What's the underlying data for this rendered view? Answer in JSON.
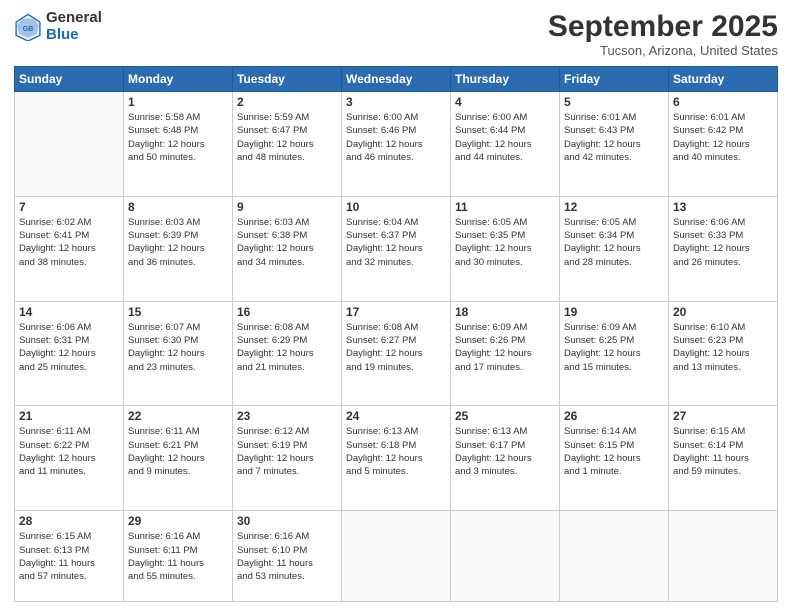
{
  "header": {
    "logo_line1": "General",
    "logo_line2": "Blue",
    "month": "September 2025",
    "location": "Tucson, Arizona, United States"
  },
  "weekdays": [
    "Sunday",
    "Monday",
    "Tuesday",
    "Wednesday",
    "Thursday",
    "Friday",
    "Saturday"
  ],
  "weeks": [
    [
      {
        "day": "",
        "info": ""
      },
      {
        "day": "1",
        "info": "Sunrise: 5:58 AM\nSunset: 6:48 PM\nDaylight: 12 hours\nand 50 minutes."
      },
      {
        "day": "2",
        "info": "Sunrise: 5:59 AM\nSunset: 6:47 PM\nDaylight: 12 hours\nand 48 minutes."
      },
      {
        "day": "3",
        "info": "Sunrise: 6:00 AM\nSunset: 6:46 PM\nDaylight: 12 hours\nand 46 minutes."
      },
      {
        "day": "4",
        "info": "Sunrise: 6:00 AM\nSunset: 6:44 PM\nDaylight: 12 hours\nand 44 minutes."
      },
      {
        "day": "5",
        "info": "Sunrise: 6:01 AM\nSunset: 6:43 PM\nDaylight: 12 hours\nand 42 minutes."
      },
      {
        "day": "6",
        "info": "Sunrise: 6:01 AM\nSunset: 6:42 PM\nDaylight: 12 hours\nand 40 minutes."
      }
    ],
    [
      {
        "day": "7",
        "info": "Sunrise: 6:02 AM\nSunset: 6:41 PM\nDaylight: 12 hours\nand 38 minutes."
      },
      {
        "day": "8",
        "info": "Sunrise: 6:03 AM\nSunset: 6:39 PM\nDaylight: 12 hours\nand 36 minutes."
      },
      {
        "day": "9",
        "info": "Sunrise: 6:03 AM\nSunset: 6:38 PM\nDaylight: 12 hours\nand 34 minutes."
      },
      {
        "day": "10",
        "info": "Sunrise: 6:04 AM\nSunset: 6:37 PM\nDaylight: 12 hours\nand 32 minutes."
      },
      {
        "day": "11",
        "info": "Sunrise: 6:05 AM\nSunset: 6:35 PM\nDaylight: 12 hours\nand 30 minutes."
      },
      {
        "day": "12",
        "info": "Sunrise: 6:05 AM\nSunset: 6:34 PM\nDaylight: 12 hours\nand 28 minutes."
      },
      {
        "day": "13",
        "info": "Sunrise: 6:06 AM\nSunset: 6:33 PM\nDaylight: 12 hours\nand 26 minutes."
      }
    ],
    [
      {
        "day": "14",
        "info": "Sunrise: 6:06 AM\nSunset: 6:31 PM\nDaylight: 12 hours\nand 25 minutes."
      },
      {
        "day": "15",
        "info": "Sunrise: 6:07 AM\nSunset: 6:30 PM\nDaylight: 12 hours\nand 23 minutes."
      },
      {
        "day": "16",
        "info": "Sunrise: 6:08 AM\nSunset: 6:29 PM\nDaylight: 12 hours\nand 21 minutes."
      },
      {
        "day": "17",
        "info": "Sunrise: 6:08 AM\nSunset: 6:27 PM\nDaylight: 12 hours\nand 19 minutes."
      },
      {
        "day": "18",
        "info": "Sunrise: 6:09 AM\nSunset: 6:26 PM\nDaylight: 12 hours\nand 17 minutes."
      },
      {
        "day": "19",
        "info": "Sunrise: 6:09 AM\nSunset: 6:25 PM\nDaylight: 12 hours\nand 15 minutes."
      },
      {
        "day": "20",
        "info": "Sunrise: 6:10 AM\nSunset: 6:23 PM\nDaylight: 12 hours\nand 13 minutes."
      }
    ],
    [
      {
        "day": "21",
        "info": "Sunrise: 6:11 AM\nSunset: 6:22 PM\nDaylight: 12 hours\nand 11 minutes."
      },
      {
        "day": "22",
        "info": "Sunrise: 6:11 AM\nSunset: 6:21 PM\nDaylight: 12 hours\nand 9 minutes."
      },
      {
        "day": "23",
        "info": "Sunrise: 6:12 AM\nSunset: 6:19 PM\nDaylight: 12 hours\nand 7 minutes."
      },
      {
        "day": "24",
        "info": "Sunrise: 6:13 AM\nSunset: 6:18 PM\nDaylight: 12 hours\nand 5 minutes."
      },
      {
        "day": "25",
        "info": "Sunrise: 6:13 AM\nSunset: 6:17 PM\nDaylight: 12 hours\nand 3 minutes."
      },
      {
        "day": "26",
        "info": "Sunrise: 6:14 AM\nSunset: 6:15 PM\nDaylight: 12 hours\nand 1 minute."
      },
      {
        "day": "27",
        "info": "Sunrise: 6:15 AM\nSunset: 6:14 PM\nDaylight: 11 hours\nand 59 minutes."
      }
    ],
    [
      {
        "day": "28",
        "info": "Sunrise: 6:15 AM\nSunset: 6:13 PM\nDaylight: 11 hours\nand 57 minutes."
      },
      {
        "day": "29",
        "info": "Sunrise: 6:16 AM\nSunset: 6:11 PM\nDaylight: 11 hours\nand 55 minutes."
      },
      {
        "day": "30",
        "info": "Sunrise: 6:16 AM\nSunset: 6:10 PM\nDaylight: 11 hours\nand 53 minutes."
      },
      {
        "day": "",
        "info": ""
      },
      {
        "day": "",
        "info": ""
      },
      {
        "day": "",
        "info": ""
      },
      {
        "day": "",
        "info": ""
      }
    ]
  ]
}
